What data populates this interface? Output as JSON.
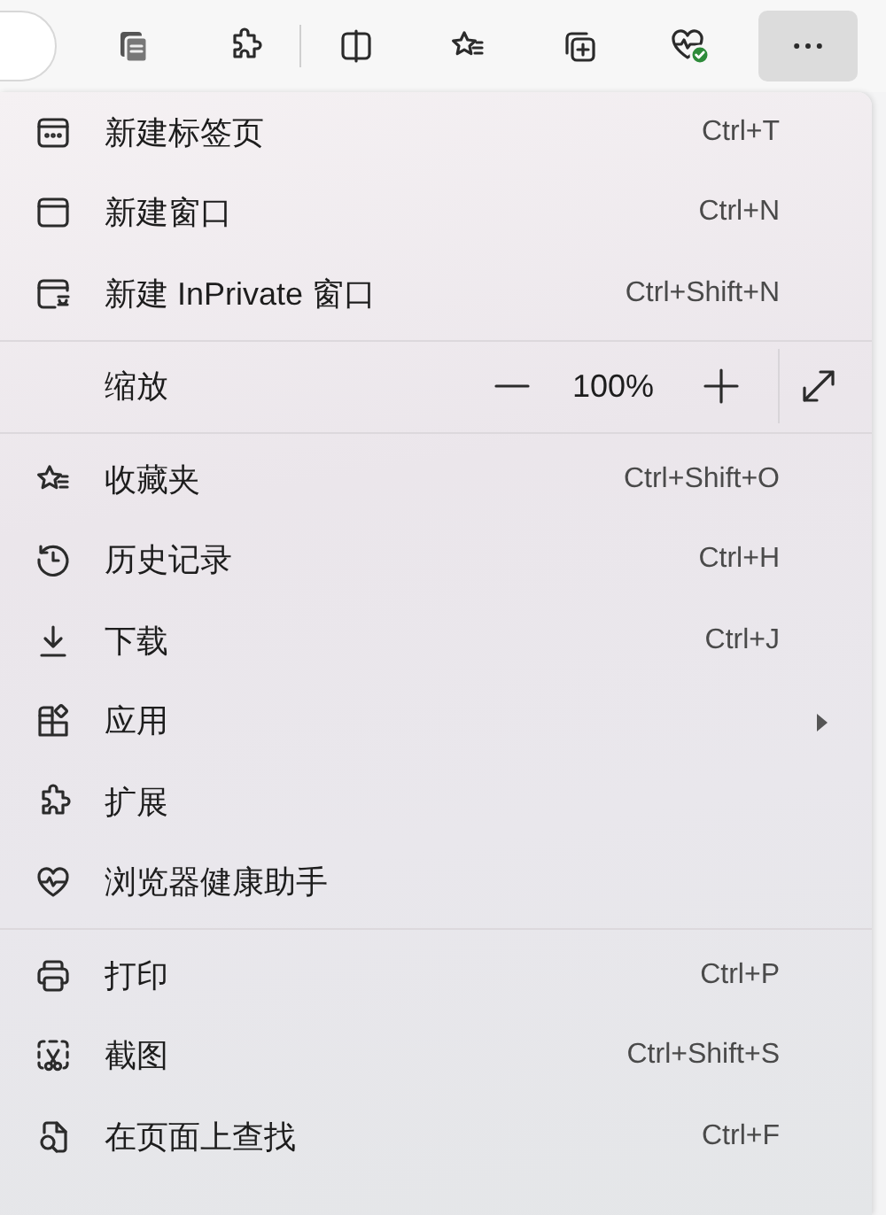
{
  "toolbar": {
    "buttons": [
      {
        "kind": "tabs",
        "pressed": false
      },
      {
        "kind": "extensions",
        "pressed": false
      },
      {
        "kind": "split",
        "pressed": false
      },
      {
        "kind": "favorites",
        "pressed": false
      },
      {
        "kind": "collections",
        "pressed": false
      },
      {
        "kind": "health",
        "pressed": false
      },
      {
        "kind": "more",
        "pressed": true
      }
    ]
  },
  "menu": {
    "sections": [
      {
        "items": [
          {
            "kind": "new-tab",
            "label": "新建标签页",
            "shortcut": "Ctrl+T",
            "submenu": false
          },
          {
            "kind": "new-window",
            "label": "新建窗口",
            "shortcut": "Ctrl+N",
            "submenu": false
          },
          {
            "kind": "inprivate",
            "label": "新建 InPrivate 窗口",
            "shortcut": "Ctrl+Shift+N",
            "submenu": false
          }
        ]
      },
      {
        "items": [
          {
            "kind": "zoom",
            "label": "缩放",
            "value": "100%"
          }
        ]
      },
      {
        "items": [
          {
            "kind": "favorites",
            "label": "收藏夹",
            "shortcut": "Ctrl+Shift+O",
            "submenu": false
          },
          {
            "kind": "history",
            "label": "历史记录",
            "shortcut": "Ctrl+H",
            "submenu": false
          },
          {
            "kind": "download",
            "label": "下载",
            "shortcut": "Ctrl+J",
            "submenu": false
          },
          {
            "kind": "apps",
            "label": "应用",
            "submenu": true
          },
          {
            "kind": "extensions",
            "label": "扩展",
            "submenu": false
          },
          {
            "kind": "health",
            "label": "浏览器健康助手",
            "submenu": false
          }
        ]
      },
      {
        "items": [
          {
            "kind": "print",
            "label": "打印",
            "shortcut": "Ctrl+P",
            "submenu": false
          },
          {
            "kind": "screenshot",
            "label": "截图",
            "shortcut": "Ctrl+Shift+S",
            "submenu": false
          },
          {
            "kind": "find",
            "label": "在页面上查找",
            "shortcut": "Ctrl+F",
            "submenu": false
          }
        ]
      }
    ]
  }
}
